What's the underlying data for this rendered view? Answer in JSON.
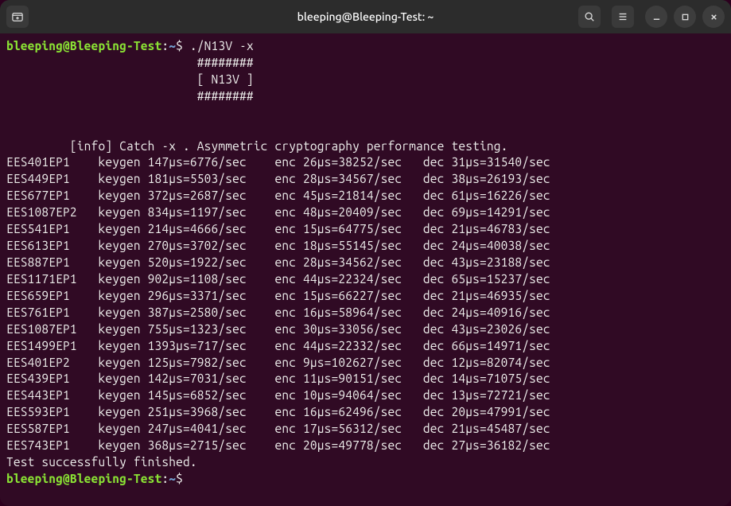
{
  "window": {
    "title": "bleeping@Bleeping-Test: ~"
  },
  "prompt": {
    "user_host": "bleeping@Bleeping-Test",
    "sep": ":",
    "path": "~",
    "dollar": "$"
  },
  "command": "./N13V -x",
  "banner": {
    "l1": "########",
    "l2": "[ N13V ]",
    "l3": "########"
  },
  "info": "[info] Catch -x . Asymmetric cryptography performance testing.",
  "rows": [
    {
      "id": "EES401EP1",
      "kg_us": 147,
      "kg_sec": 6776,
      "enc_us": 26,
      "enc_sec": 38252,
      "dec_us": 31,
      "dec_sec": 31540
    },
    {
      "id": "EES449EP1",
      "kg_us": 181,
      "kg_sec": 5503,
      "enc_us": 28,
      "enc_sec": 34567,
      "dec_us": 38,
      "dec_sec": 26193
    },
    {
      "id": "EES677EP1",
      "kg_us": 372,
      "kg_sec": 2687,
      "enc_us": 45,
      "enc_sec": 21814,
      "dec_us": 61,
      "dec_sec": 16226
    },
    {
      "id": "EES1087EP2",
      "kg_us": 834,
      "kg_sec": 1197,
      "enc_us": 48,
      "enc_sec": 20409,
      "dec_us": 69,
      "dec_sec": 14291
    },
    {
      "id": "EES541EP1",
      "kg_us": 214,
      "kg_sec": 4666,
      "enc_us": 15,
      "enc_sec": 64775,
      "dec_us": 21,
      "dec_sec": 46783
    },
    {
      "id": "EES613EP1",
      "kg_us": 270,
      "kg_sec": 3702,
      "enc_us": 18,
      "enc_sec": 55145,
      "dec_us": 24,
      "dec_sec": 40038
    },
    {
      "id": "EES887EP1",
      "kg_us": 520,
      "kg_sec": 1922,
      "enc_us": 28,
      "enc_sec": 34562,
      "dec_us": 43,
      "dec_sec": 23188
    },
    {
      "id": "EES1171EP1",
      "kg_us": 902,
      "kg_sec": 1108,
      "enc_us": 44,
      "enc_sec": 22324,
      "dec_us": 65,
      "dec_sec": 15237
    },
    {
      "id": "EES659EP1",
      "kg_us": 296,
      "kg_sec": 3371,
      "enc_us": 15,
      "enc_sec": 66227,
      "dec_us": 21,
      "dec_sec": 46935
    },
    {
      "id": "EES761EP1",
      "kg_us": 387,
      "kg_sec": 2580,
      "enc_us": 16,
      "enc_sec": 58964,
      "dec_us": 24,
      "dec_sec": 40916
    },
    {
      "id": "EES1087EP1",
      "kg_us": 755,
      "kg_sec": 1323,
      "enc_us": 30,
      "enc_sec": 33056,
      "dec_us": 43,
      "dec_sec": 23026
    },
    {
      "id": "EES1499EP1",
      "kg_us": 1393,
      "kg_sec": 717,
      "enc_us": 44,
      "enc_sec": 22332,
      "dec_us": 66,
      "dec_sec": 14971
    },
    {
      "id": "EES401EP2",
      "kg_us": 125,
      "kg_sec": 7982,
      "enc_us": 9,
      "enc_sec": 102627,
      "dec_us": 12,
      "dec_sec": 82074
    },
    {
      "id": "EES439EP1",
      "kg_us": 142,
      "kg_sec": 7031,
      "enc_us": 11,
      "enc_sec": 90151,
      "dec_us": 14,
      "dec_sec": 71075
    },
    {
      "id": "EES443EP1",
      "kg_us": 145,
      "kg_sec": 6852,
      "enc_us": 10,
      "enc_sec": 94064,
      "dec_us": 13,
      "dec_sec": 72721
    },
    {
      "id": "EES593EP1",
      "kg_us": 251,
      "kg_sec": 3968,
      "enc_us": 16,
      "enc_sec": 62496,
      "dec_us": 20,
      "dec_sec": 47991
    },
    {
      "id": "EES587EP1",
      "kg_us": 247,
      "kg_sec": 4041,
      "enc_us": 17,
      "enc_sec": 56312,
      "dec_us": 21,
      "dec_sec": 45487
    },
    {
      "id": "EES743EP1",
      "kg_us": 368,
      "kg_sec": 2715,
      "enc_us": 20,
      "enc_sec": 49778,
      "dec_us": 27,
      "dec_sec": 36182
    }
  ],
  "finish": "Test successfully finished."
}
